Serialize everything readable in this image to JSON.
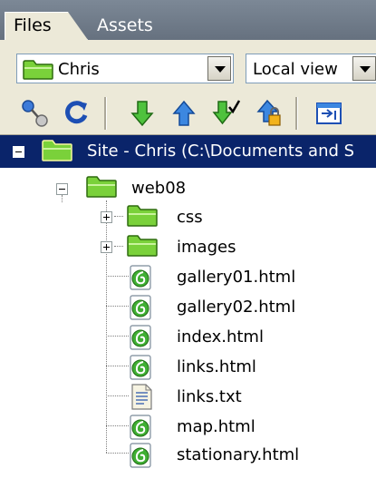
{
  "tabs": [
    {
      "label": "Files",
      "active": true
    },
    {
      "label": "Assets",
      "active": false
    }
  ],
  "toolbar": {
    "site_select": {
      "value": "Chris",
      "icon": "folder-icon"
    },
    "view_select": {
      "value": "Local view"
    },
    "icons": [
      "connect-icon",
      "refresh-icon",
      "get-files-icon",
      "put-files-icon",
      "check-out-icon",
      "check-in-icon",
      "expand-panel-icon"
    ]
  },
  "tree": {
    "root": {
      "label": "Site - Chris (C:\\Documents and S",
      "icon": "folder-icon"
    },
    "folder": {
      "label": "web08",
      "icon": "folder-icon"
    },
    "subfolders": [
      {
        "label": "css",
        "icon": "folder-icon"
      },
      {
        "label": "images",
        "icon": "folder-icon"
      }
    ],
    "files": [
      {
        "label": "gallery01.html",
        "icon": "html-file-icon"
      },
      {
        "label": "gallery02.html",
        "icon": "html-file-icon"
      },
      {
        "label": "index.html",
        "icon": "html-file-icon"
      },
      {
        "label": "links.html",
        "icon": "html-file-icon"
      },
      {
        "label": "links.txt",
        "icon": "text-file-icon"
      },
      {
        "label": "map.html",
        "icon": "html-file-icon"
      },
      {
        "label": "stationary.html",
        "icon": "html-file-icon"
      }
    ]
  },
  "colors": {
    "selection": "#0a246a",
    "tabstrip": "#6f7a88",
    "toolbar": "#ece9d8",
    "folder": "#7ad13a",
    "arrow_green": "#3fae33"
  }
}
